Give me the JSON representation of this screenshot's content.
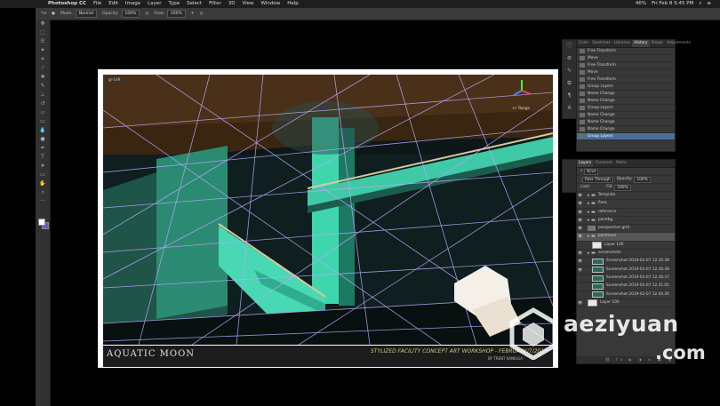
{
  "menubar": {
    "app": "Photoshop CC",
    "items": [
      "File",
      "Edit",
      "Image",
      "Layer",
      "Type",
      "Select",
      "Filter",
      "3D",
      "View",
      "Window",
      "Help"
    ],
    "status": {
      "battery": "46%",
      "clock": "Fri Feb 8  5:45 PM"
    }
  },
  "options": {
    "mode_label": "Mode:",
    "mode_value": "Normal",
    "opacity_label": "Opacity:",
    "opacity_value": "100%",
    "flow_label": "Flow:",
    "flow_value": "100%"
  },
  "canvas": {
    "grid_tag": "gr-149",
    "gizmo_label": "+/- Range",
    "title_left": "AQUATIC MOON",
    "title_right": "STYLIZED FACILITY CONCEPT ART WORKSHOP - FEBRUARY/7/2019",
    "subtitle": "BY TRENT KANIUGA"
  },
  "history": {
    "tabs": [
      "Color",
      "Swatches",
      "Libraries",
      "History",
      "Shape",
      "Adjustments"
    ],
    "active_tab": "History",
    "items": [
      "Free Transform",
      "Move",
      "Free Transform",
      "Move",
      "Free Transform",
      "Group Layers",
      "Name Change",
      "Name Change",
      "Group Layers",
      "Name Change",
      "Name Change",
      "Name Change",
      "Group Layers"
    ],
    "selected_index": 12
  },
  "layers": {
    "tabs": [
      "Layers",
      "Channels",
      "Paths"
    ],
    "active_tab": "Layers",
    "filter": "Kind",
    "blend": "Pass Through",
    "opacity_label": "Opacity:",
    "opacity_value": "100%",
    "lock_label": "Lock:",
    "fill_label": "Fill:",
    "fill_value": "100%",
    "rows": [
      {
        "name": "Template",
        "kind": "folder",
        "visible": true,
        "indent": 1
      },
      {
        "name": "fixes",
        "kind": "folder",
        "visible": true,
        "indent": 1
      },
      {
        "name": "reference",
        "kind": "folder",
        "visible": true,
        "indent": 1
      },
      {
        "name": "paintbg",
        "kind": "folder",
        "visible": true,
        "indent": 1
      },
      {
        "name": "perspective grid",
        "kind": "layer",
        "visible": true,
        "indent": 1
      },
      {
        "name": "paintover",
        "kind": "folder",
        "visible": true,
        "indent": 1,
        "selected": true
      },
      {
        "name": "Layer 146",
        "kind": "white",
        "visible": false,
        "indent": 2
      },
      {
        "name": "screenshots",
        "kind": "folder",
        "visible": true,
        "indent": 1
      },
      {
        "name": "Screenshot 2019-02-07 12.30.38",
        "kind": "img",
        "visible": true,
        "indent": 2
      },
      {
        "name": "Screenshot 2019-02-07 12.30.38",
        "kind": "img",
        "visible": true,
        "indent": 2
      },
      {
        "name": "Screenshot 2019-02-07 12.30.37",
        "kind": "img",
        "visible": false,
        "indent": 2
      },
      {
        "name": "Screenshot 2019-02-07 12.31.01",
        "kind": "img",
        "visible": false,
        "indent": 2
      },
      {
        "name": "Screenshot 2019-02-07 12.40.30",
        "kind": "img",
        "visible": false,
        "indent": 2
      },
      {
        "name": "Layer 100",
        "kind": "white",
        "visible": true,
        "indent": 1
      }
    ]
  },
  "watermark": {
    "text": "aeziyuan",
    "tld": ".com"
  }
}
